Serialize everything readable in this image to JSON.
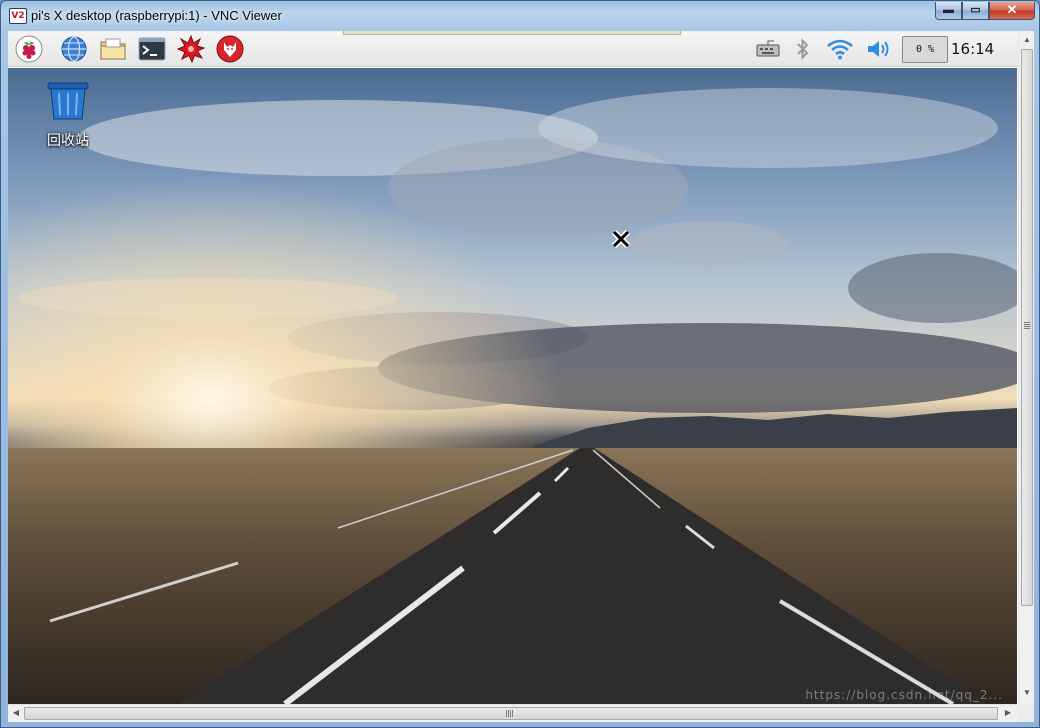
{
  "window": {
    "title": "pi's X desktop (raspberrypi:1) - VNC Viewer",
    "app_icon_text": "V2",
    "buttons": {
      "minimize": "▬",
      "maximize": "▭",
      "close": "✕"
    }
  },
  "panel": {
    "launchers": [
      {
        "name": "raspberry-menu",
        "icon": "raspberry-icon"
      },
      {
        "name": "web-browser",
        "icon": "globe-icon"
      },
      {
        "name": "file-manager",
        "icon": "folder-icon"
      },
      {
        "name": "terminal",
        "icon": "terminal-icon"
      },
      {
        "name": "math-kernel",
        "icon": "starburst-icon"
      },
      {
        "name": "wolfram",
        "icon": "wolf-icon"
      }
    ],
    "tray": {
      "icons": [
        "keyboard-icon",
        "bluetooth-icon",
        "wifi-icon",
        "volume-icon"
      ],
      "cpu_usage": "0 %",
      "clock": "16:14"
    }
  },
  "desktop": {
    "icons": [
      {
        "label": "回收站",
        "icon": "trash-icon"
      }
    ],
    "watermark": "https://blog.csdn.net/qq_2...",
    "colors": {
      "sky_top": "#4a6b92",
      "horizon": "#f1ddb8",
      "road": "#2c2b2a"
    }
  }
}
